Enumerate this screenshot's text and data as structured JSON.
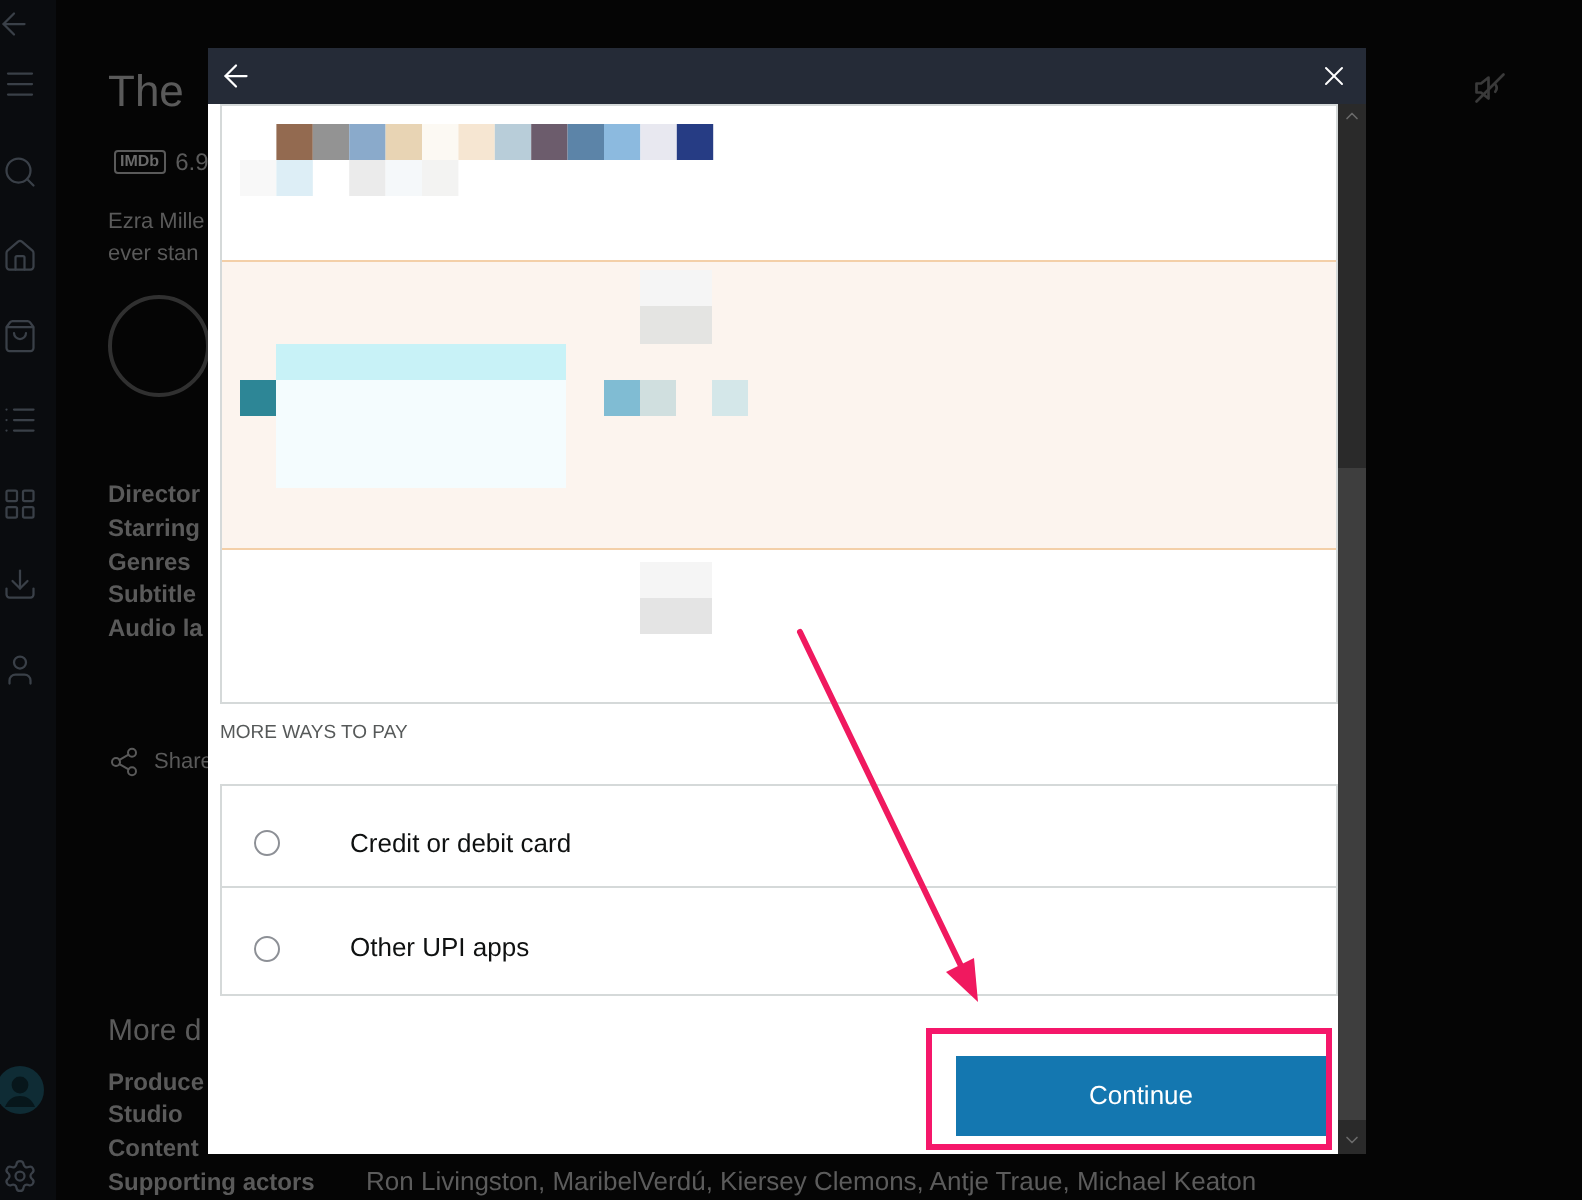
{
  "background_page": {
    "title": "The",
    "imdb_badge": "IMDb",
    "rating": "6.9",
    "synopsis": [
      "Ezra Mille",
      "ever stan"
    ],
    "details": [
      "Director",
      "Starring",
      "Genres",
      "Subtitle",
      "Audio la"
    ],
    "share": "Share",
    "more_details": {
      "heading": "More d",
      "rows": [
        {
          "label": "Produce"
        },
        {
          "label": "Studio"
        },
        {
          "label": "Content"
        },
        {
          "label": "Supporting actors",
          "value": "Ron Livingston, MaribelVerdú, Kiersey Clemons, Antje Traue, Michael Keaton"
        }
      ]
    }
  },
  "dialog": {
    "saved_option": {
      "selected": true
    },
    "section_label": "MORE WAYS TO PAY",
    "options": [
      {
        "label": "Credit or debit card",
        "selected": false
      },
      {
        "label": "Other UPI apps",
        "selected": false
      }
    ],
    "continue_button": "Continue"
  }
}
